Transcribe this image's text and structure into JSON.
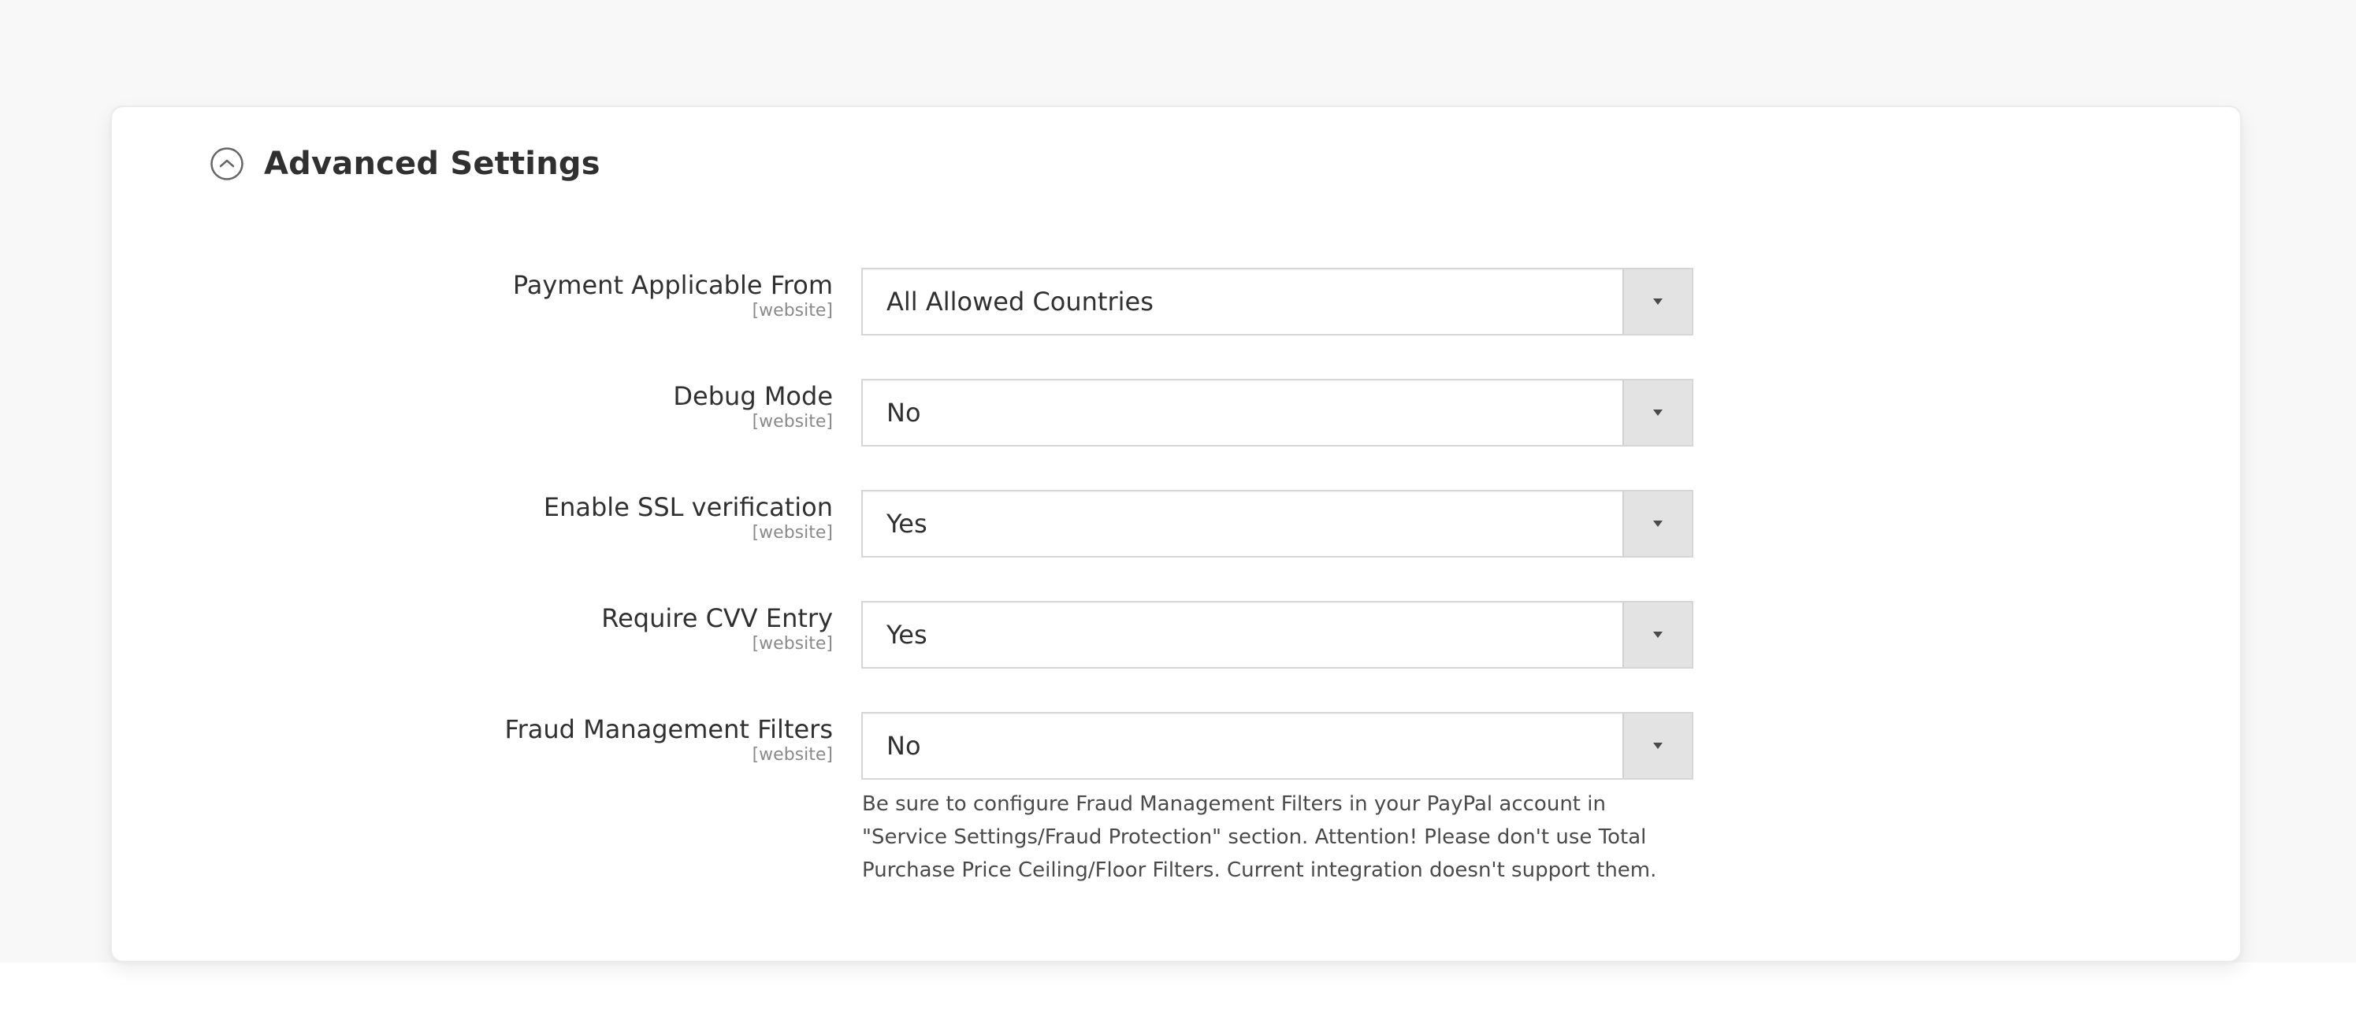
{
  "section": {
    "title": "Advanced Settings",
    "collapse_icon": "collapse-circle-chevron-up-icon",
    "expanded": true
  },
  "fields": [
    {
      "label": "Payment Applicable From",
      "scope": "[website]",
      "value": "All Allowed Countries"
    },
    {
      "label": "Debug Mode",
      "scope": "[website]",
      "value": "No"
    },
    {
      "label": "Enable SSL verification",
      "scope": "[website]",
      "value": "Yes"
    },
    {
      "label": "Require CVV Entry",
      "scope": "[website]",
      "value": "Yes"
    },
    {
      "label": "Fraud Management Filters",
      "scope": "[website]",
      "value": "No",
      "note": "Be sure to configure Fraud Management Filters in your PayPal account in \"Service Settings/Fraud Protection\" section. Attention! Please don't use Total Purchase Price Ceiling/Floor Filters. Current integration doesn't support them."
    }
  ],
  "icons": {
    "select_arrow": "triangle-down-icon"
  }
}
